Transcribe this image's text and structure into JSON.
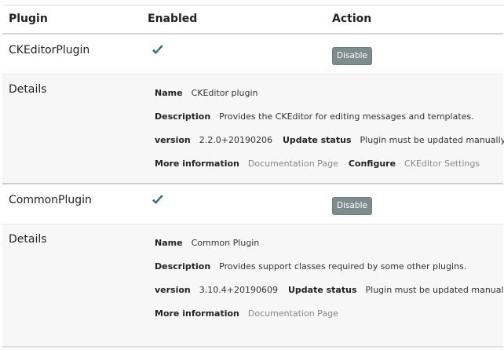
{
  "header": {
    "col_plugin": "Plugin",
    "col_enabled": "Enabled",
    "col_action": "Action"
  },
  "plugins": [
    {
      "name": "CKEditorPlugin",
      "enabled_icon": "checkmark-icon",
      "action_label": "Disable",
      "details_label": "Details",
      "details": {
        "name_label": "Name",
        "name_value": "CKEditor plugin",
        "description_label": "Description",
        "description_value": "Provides the CKEditor for editing messages and templates.",
        "version_label": "version",
        "version_value": "2.2.0+20190206",
        "update_label": "Update status",
        "update_value": "Plugin must be updated manually",
        "more_label": "More information",
        "more_link": "Documentation Page",
        "configure_label": "Configure",
        "configure_link": "CKEditor Settings"
      }
    },
    {
      "name": "CommonPlugin",
      "enabled_icon": "checkmark-icon",
      "action_label": "Disable",
      "details_label": "Details",
      "details": {
        "name_label": "Name",
        "name_value": "Common Plugin",
        "description_label": "Description",
        "description_value": "Provides support classes required by some other plugins.",
        "version_label": "version",
        "version_value": "3.10.4+20190609",
        "update_label": "Update status",
        "update_value": "Plugin must be updated manually",
        "more_label": "More information",
        "more_link": "Documentation Page"
      }
    }
  ],
  "colors": {
    "check": "#3a6f79",
    "button_bg": "#7f8c8d",
    "link": "#888888",
    "details_bg": "#f7f7f7"
  }
}
